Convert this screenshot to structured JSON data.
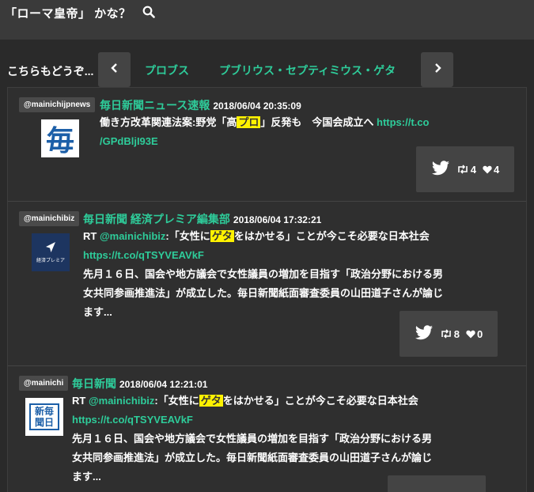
{
  "search": {
    "query": "「ローマ皇帝」 かな？"
  },
  "related": {
    "label": "こちらもどうぞ...",
    "links": [
      "プロブス",
      "プブリウス・セプティミウス・ゲタ"
    ]
  },
  "tweets": [
    {
      "handle": "@mainichijpnews",
      "name": "毎日新聞ニュース速報",
      "date": "2018/06/04 20:35:09",
      "text_before": "働き方改革関連法案:野党「高",
      "highlight": "プロ",
      "text_after": "」反発も　今国会成立へ",
      "link1": "https://t.co",
      "link2": "/GPdBljI93E",
      "retweets": "4",
      "likes": "4"
    },
    {
      "handle": "@mainichibiz",
      "name": "毎日新聞 経済プレミア編集部",
      "date": "2018/06/04 17:32:21",
      "rt_prefix": "RT ",
      "rt_handle": "@mainichibiz",
      "text_before": ":「女性に",
      "highlight": "ゲタ",
      "text_after": "をはかせる」ことが今こそ必要な日本社会",
      "link1": "https://t.co/qTSYVEAVkF",
      "line3": "先月１６日、国会や地方議会で女性議員の増加を目指す「政治分野における男",
      "line4": "女共同参画推進法」が成立した。毎日新聞紙面審査委員の山田道子さんが論じ",
      "line5": "ます...",
      "retweets": "8",
      "likes": "0"
    },
    {
      "handle": "@mainichi",
      "name": "毎日新聞",
      "date": "2018/06/04 12:21:01",
      "rt_prefix": "RT ",
      "rt_handle": "@mainichibiz",
      "text_before": ":「女性に",
      "highlight": "ゲタ",
      "text_after": "をはかせる」ことが今こそ必要な日本社会",
      "link1": "https://t.co/qTSYVEAVkF",
      "line3": "先月１６日、国会や地方議会で女性議員の増加を目指す「政治分野における男",
      "line4": "女共同参画推進法」が成立した。毎日新聞紙面審査委員の山田道子さんが論じ",
      "line5": "ます..."
    }
  ],
  "avatars": {
    "t1": "毎",
    "t2": "経済プレミア",
    "t3a": "新毎",
    "t3b": "聞日"
  },
  "colors": {
    "accent": "#2ecc9a",
    "highlight": "#fff200",
    "background": "#2a2a2a"
  }
}
